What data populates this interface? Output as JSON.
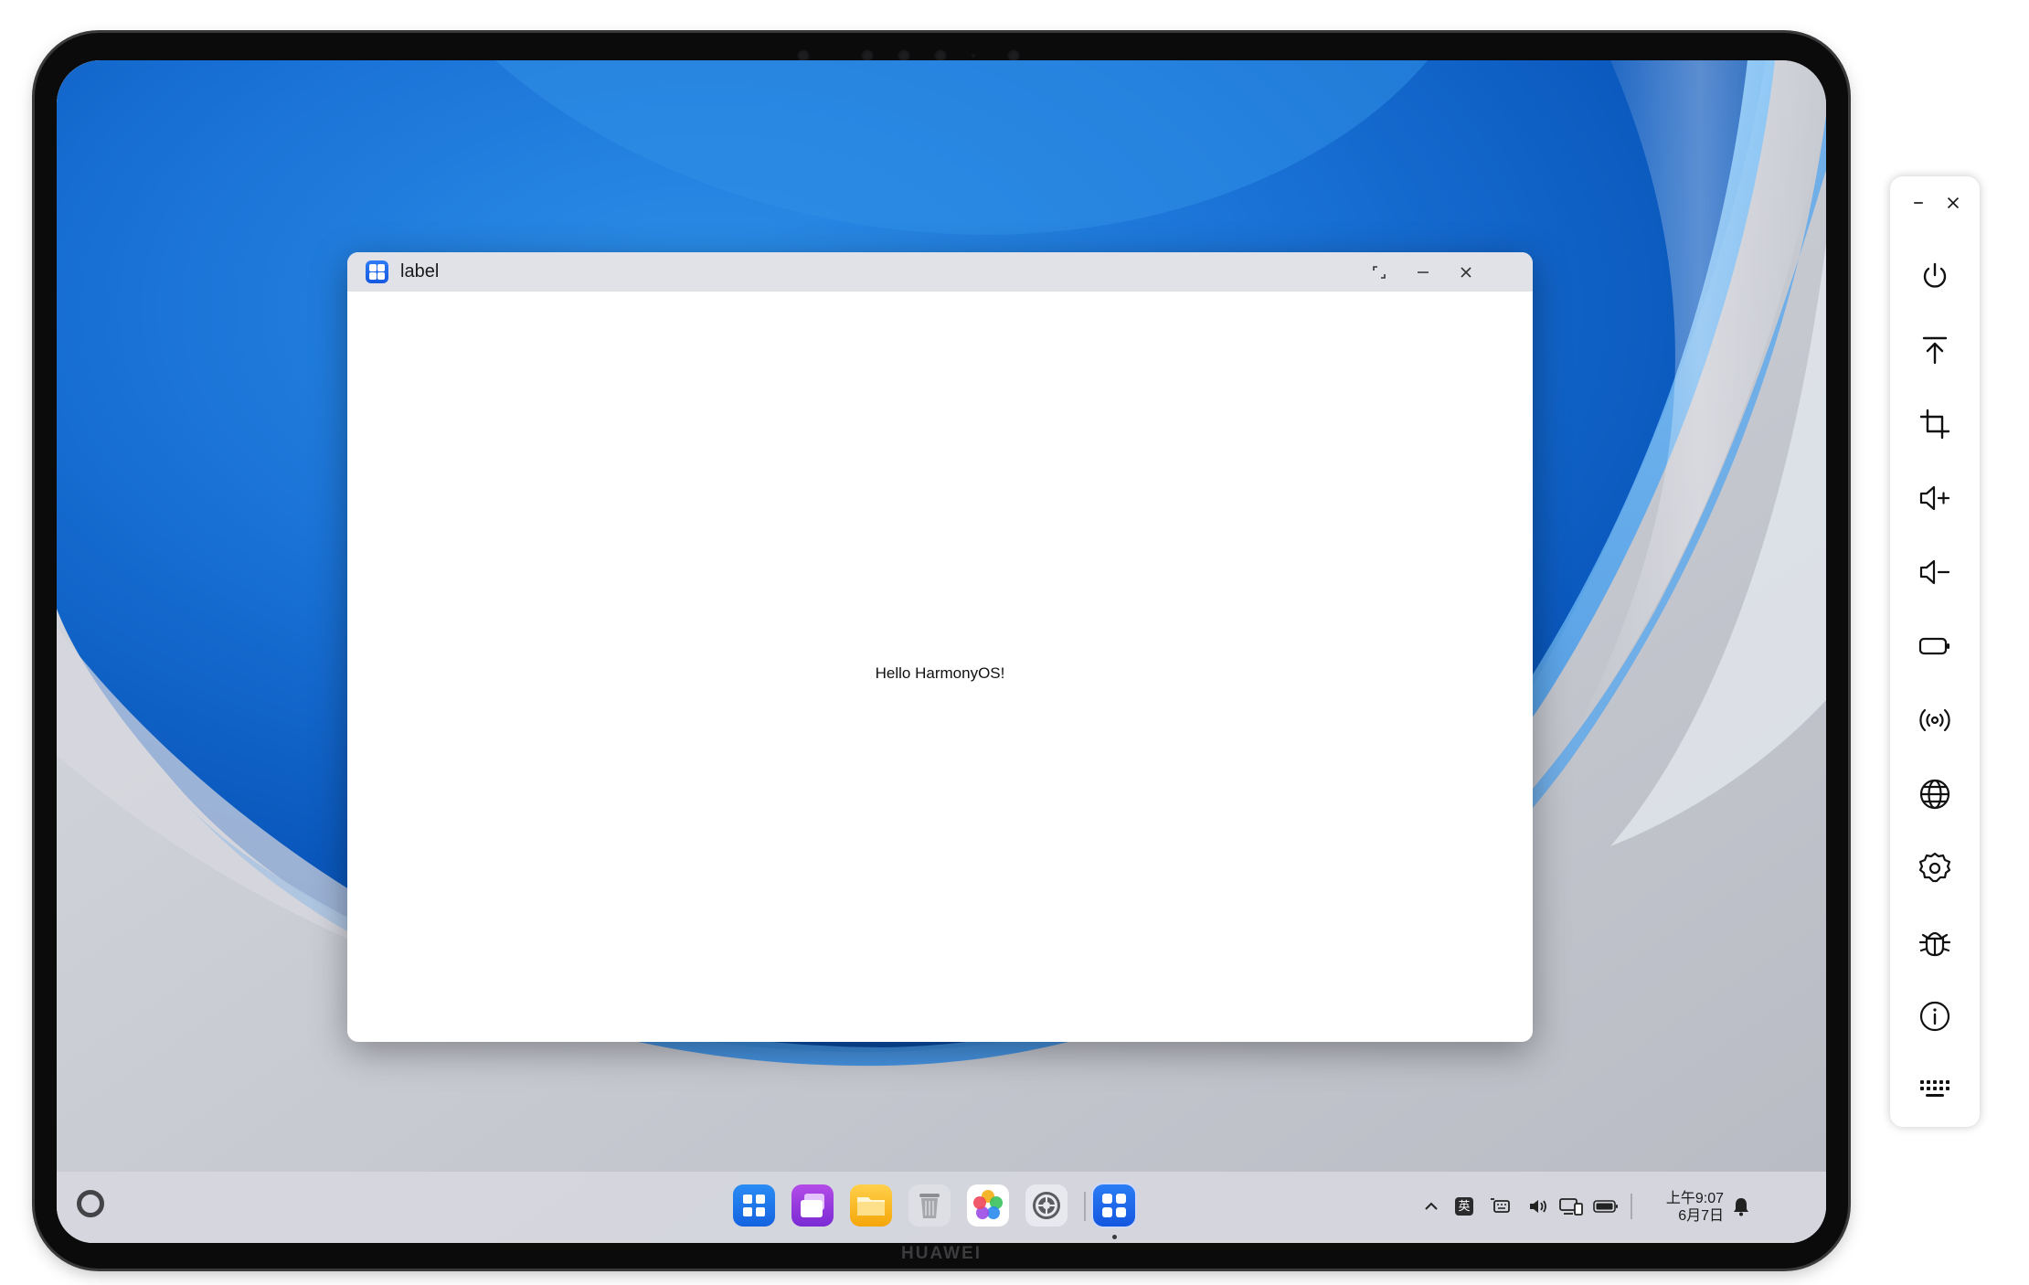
{
  "window": {
    "title": "label",
    "content_text": "Hello HarmonyOS!"
  },
  "device": {
    "brand": "HUAWEI"
  },
  "taskbar": {
    "dock_apps": [
      "app-center",
      "multi-window",
      "files",
      "trash",
      "gallery",
      "settings",
      "label-app"
    ],
    "tray": {
      "input_method": "英",
      "clock_time": "上午9:07",
      "clock_date": "6月7日"
    }
  },
  "side_toolbar": {
    "items": [
      "minimize",
      "close",
      "power",
      "home-top",
      "screenshot-crop",
      "volume-up",
      "volume-down",
      "battery",
      "location-signal",
      "network-globe",
      "settings",
      "debug",
      "about-info",
      "keyboard"
    ]
  },
  "colors": {
    "accent": "#1f6ff2",
    "titlebar": "#e1e2e8",
    "wallpaper_blue": "#0a63c8"
  }
}
